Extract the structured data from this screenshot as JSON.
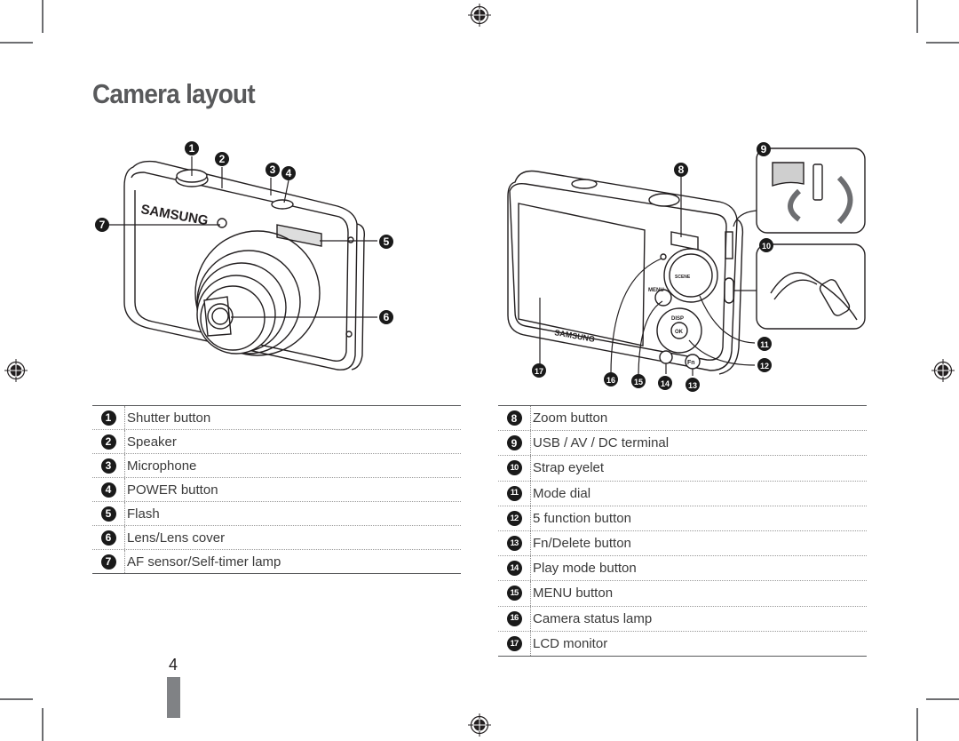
{
  "page": {
    "title": "Camera layout",
    "page_number": "4"
  },
  "front_view": {
    "brand_label": "SAMSUNG",
    "callouts": [
      "1",
      "2",
      "3",
      "4",
      "5",
      "6",
      "7"
    ]
  },
  "back_view": {
    "brand_label": "SAMSUNG",
    "callouts": [
      "8",
      "9",
      "10",
      "11",
      "12",
      "13",
      "14",
      "15",
      "16",
      "17"
    ],
    "button_labels": {
      "menu": "MENU",
      "disp": "DISP",
      "ok": "OK",
      "fn": "Fn",
      "scene": "SCENE"
    }
  },
  "legend_left": [
    {
      "num": "1",
      "label": "Shutter button"
    },
    {
      "num": "2",
      "label": "Speaker"
    },
    {
      "num": "3",
      "label": "Microphone"
    },
    {
      "num": "4",
      "label": "POWER button"
    },
    {
      "num": "5",
      "label": "Flash"
    },
    {
      "num": "6",
      "label": "Lens/Lens cover"
    },
    {
      "num": "7",
      "label": "AF sensor/Self-timer lamp"
    }
  ],
  "legend_right": [
    {
      "num": "8",
      "label": "Zoom button"
    },
    {
      "num": "9",
      "label": "USB / AV / DC terminal"
    },
    {
      "num": "10",
      "label": "Strap eyelet"
    },
    {
      "num": "11",
      "label": "Mode dial"
    },
    {
      "num": "12",
      "label": "5 function button"
    },
    {
      "num": "13",
      "label": "Fn/Delete button"
    },
    {
      "num": "14",
      "label": "Play mode button"
    },
    {
      "num": "15",
      "label": "MENU button"
    },
    {
      "num": "16",
      "label": "Camera status lamp"
    },
    {
      "num": "17",
      "label": "LCD monitor"
    }
  ]
}
